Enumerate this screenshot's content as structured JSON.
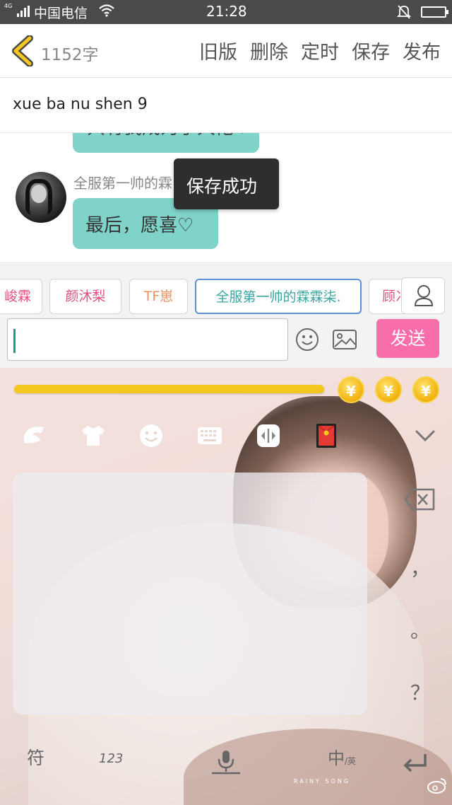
{
  "status_bar": {
    "network": "4G",
    "carrier": "中国电信",
    "time": "21:28"
  },
  "editor": {
    "word_count": "1152字",
    "actions": [
      "旧版",
      "删除",
      "定时",
      "保存",
      "发布"
    ],
    "title": "xue ba nu shen 9"
  },
  "chat": {
    "partial_message": "只有我成为了大佬♡",
    "sender_name": "全服第一帅的霖",
    "last_message": "最后，愿喜♡"
  },
  "toast": {
    "text": "保存成功"
  },
  "tags": [
    "峻霖",
    "颜沐梨",
    "TF崽",
    "全服第一帅的霖霖柒.",
    "顾冫"
  ],
  "input": {
    "value": "",
    "send_label": "发送"
  },
  "keyboard": {
    "progress": 0.72,
    "coin_symbol": "¥",
    "side_keys": {
      "comma": "，",
      "period": "。",
      "question": "？"
    },
    "bottom_keys": {
      "symbols": "符",
      "numbers": "123",
      "lang_main": "中",
      "lang_sub": "/英"
    },
    "watermark": "RAINY SONG"
  },
  "colors": {
    "accent_teal": "#7fd3c8",
    "send_pink": "#f76eaa",
    "back_arrow": "#f4c820"
  }
}
